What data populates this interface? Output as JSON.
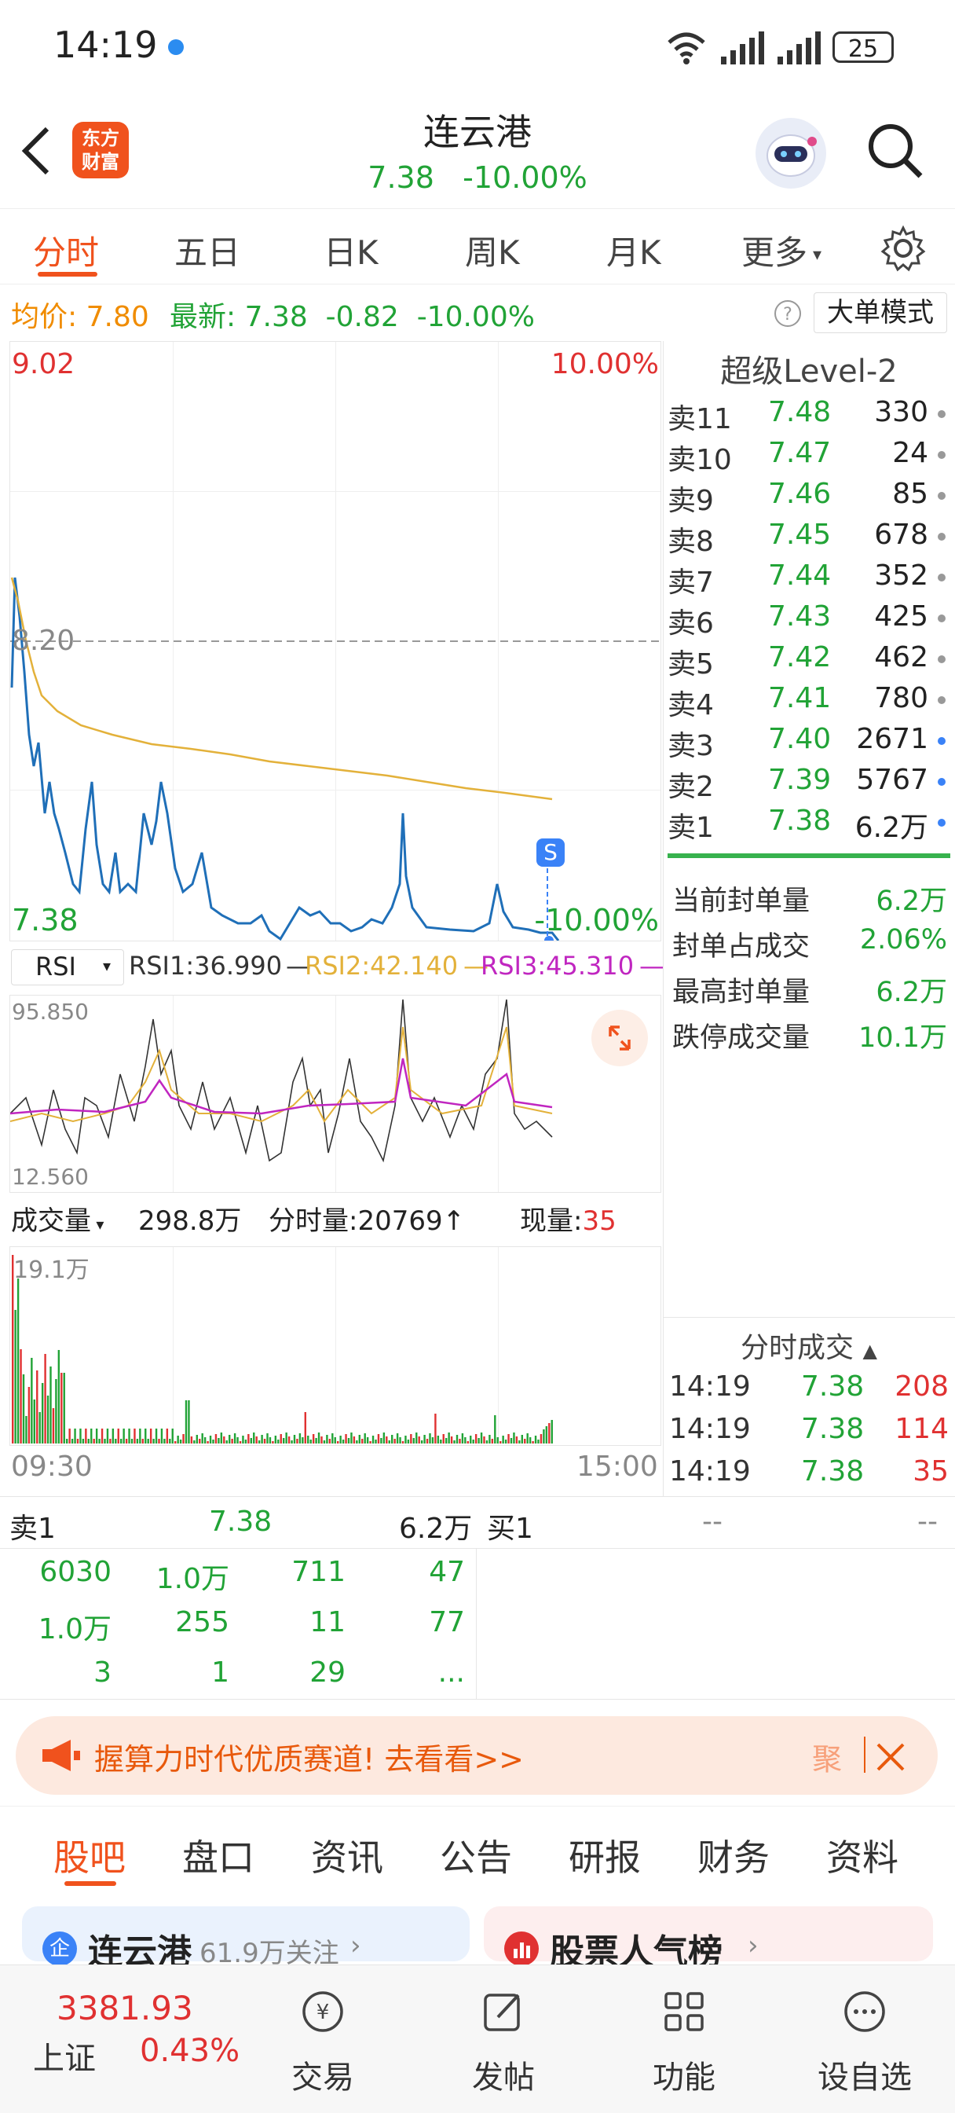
{
  "status_bar": {
    "time": "14:19",
    "battery": "25"
  },
  "header": {
    "logo_line1": "东方",
    "logo_line2": "财富",
    "title": "连云港",
    "price": "7.38",
    "change_pct": "-10.00%"
  },
  "tabs": [
    "分时",
    "五日",
    "日K",
    "周K",
    "月K",
    "更多"
  ],
  "info_line": {
    "avg_label": "均价:",
    "avg_value": "7.80",
    "latest_label": "最新:",
    "latest_value": "7.38",
    "change": "-0.82",
    "change_pct": "-10.00%",
    "big_order_mode": "大单模式"
  },
  "price_chart": {
    "top_price": "9.02",
    "top_pct": "10.00%",
    "mid_price": "8.20",
    "bottom_price": "7.38",
    "bottom_pct": "-10.00%",
    "s_marker": "S"
  },
  "rsi": {
    "selector": "RSI",
    "rsi1": "RSI1:36.990",
    "rsi2": "RSI2:42.140",
    "rsi3": "RSI3:45.310",
    "max": "95.850",
    "min": "12.560"
  },
  "volume": {
    "selector": "成交量",
    "total": "298.8万",
    "minute_label": "分时量:20769↑",
    "current_label": "现量:",
    "current_value": "35",
    "max": "19.1万",
    "start_time": "09:30",
    "end_time": "15:00"
  },
  "level2": {
    "title": "超级Level-2",
    "asks": [
      {
        "label": "卖11",
        "price": "7.48",
        "vol": "330"
      },
      {
        "label": "卖10",
        "price": "7.47",
        "vol": "24"
      },
      {
        "label": "卖9",
        "price": "7.46",
        "vol": "85"
      },
      {
        "label": "卖8",
        "price": "7.45",
        "vol": "678"
      },
      {
        "label": "卖7",
        "price": "7.44",
        "vol": "352"
      },
      {
        "label": "卖6",
        "price": "7.43",
        "vol": "425"
      },
      {
        "label": "卖5",
        "price": "7.42",
        "vol": "462"
      },
      {
        "label": "卖4",
        "price": "7.41",
        "vol": "780"
      },
      {
        "label": "卖3",
        "price": "7.40",
        "vol": "2671"
      },
      {
        "label": "卖2",
        "price": "7.39",
        "vol": "5767"
      },
      {
        "label": "卖1",
        "price": "7.38",
        "vol": "6.2万"
      }
    ],
    "stats": [
      {
        "key": "当前封单量",
        "value": "6.2万"
      },
      {
        "key": "封单占成交",
        "value": "2.06%"
      },
      {
        "key": "最高封单量",
        "value": "6.2万"
      },
      {
        "key": "跌停成交量",
        "value": "10.1万"
      }
    ],
    "ticks_title": "分时成交",
    "ticks": [
      {
        "time": "14:19",
        "price": "7.38",
        "vol": "208"
      },
      {
        "time": "14:19",
        "price": "7.38",
        "vol": "114"
      },
      {
        "time": "14:19",
        "price": "7.38",
        "vol": "35"
      }
    ]
  },
  "queue": {
    "sell_label": "卖1",
    "sell_price": "7.38",
    "sell_vol": "6.2万",
    "buy_label": "买1",
    "buy_price": "--",
    "buy_vol": "--",
    "cells": [
      [
        "6030",
        "1.0万",
        "711",
        "47"
      ],
      [
        "1.0万",
        "255",
        "11",
        "77"
      ],
      [
        "3",
        "1",
        "29",
        "..."
      ]
    ]
  },
  "banner": {
    "text": "握算力时代优质赛道!  去看看>>",
    "right_text": "聚"
  },
  "bottom_tabs": [
    "股吧",
    "盘口",
    "资讯",
    "公告",
    "研报",
    "财务",
    "资料"
  ],
  "cards": {
    "left_title": "连云港",
    "left_sub": "61.9万关注",
    "right_title": "股票人气榜"
  },
  "navbar": {
    "index_value": "3381.93",
    "index_name": "上证",
    "index_change": "0.43%",
    "items": [
      "交易",
      "发帖",
      "功能",
      "设自选"
    ]
  }
}
